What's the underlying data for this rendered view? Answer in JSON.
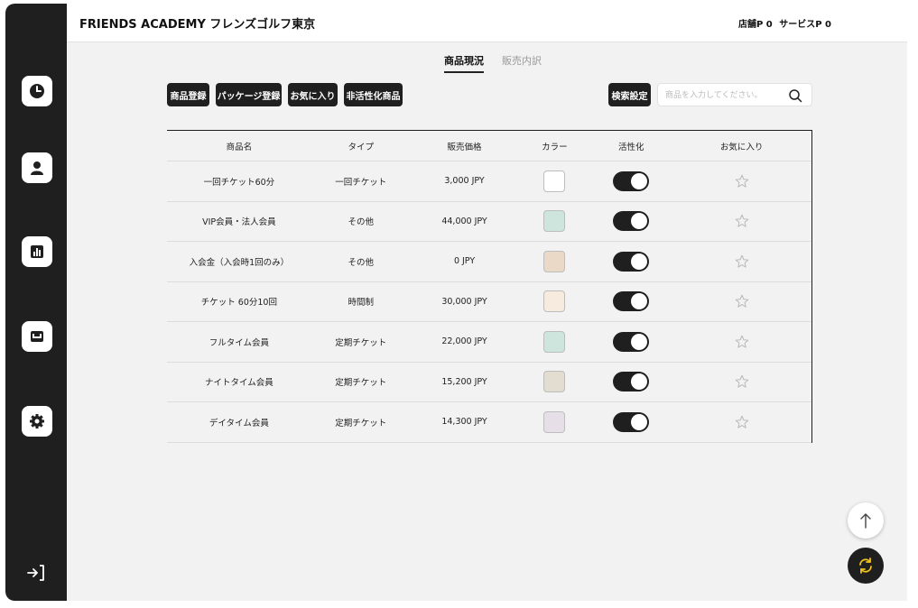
{
  "header": {
    "brand": "FRIENDS ACADEMY フレンズゴルフ東京",
    "store_points": "店舗P 0",
    "service_points": "サービスP 0"
  },
  "tabs": [
    {
      "label": "商品現況",
      "active": true
    },
    {
      "label": "販売内訳",
      "active": false
    }
  ],
  "toolbar": {
    "register_product": "商品登録",
    "register_package": "パッケージ登録",
    "favorites": "お気に入り",
    "inactive_products": "非活性化商品",
    "search_settings": "検索設定",
    "search_placeholder": "商品を入力してください。"
  },
  "table": {
    "columns": [
      "商品名",
      "タイプ",
      "販売価格",
      "カラー",
      "活性化",
      "お気に入り"
    ],
    "rows": [
      {
        "name": "一回チケット60分",
        "type": "一回チケット",
        "price": "3,000 JPY",
        "color": "#ffffff",
        "active": true,
        "favorite": false
      },
      {
        "name": "VIP会員・法人会員",
        "type": "その他",
        "price": "44,000 JPY",
        "color": "#cde5dc",
        "active": true,
        "favorite": false
      },
      {
        "name": "入会金（入会時1回のみ）",
        "type": "その他",
        "price": "0 JPY",
        "color": "#ead9c7",
        "active": true,
        "favorite": false
      },
      {
        "name": "チケット 60分10回",
        "type": "時間制",
        "price": "30,000 JPY",
        "color": "#f7ebdf",
        "active": true,
        "favorite": false
      },
      {
        "name": "フルタイム会員",
        "type": "定期チケット",
        "price": "22,000 JPY",
        "color": "#cde5dc",
        "active": true,
        "favorite": false
      },
      {
        "name": "ナイトタイム会員",
        "type": "定期チケット",
        "price": "15,200 JPY",
        "color": "#e3ddd1",
        "active": true,
        "favorite": false
      },
      {
        "name": "デイタイム会員",
        "type": "定期チケット",
        "price": "14,300 JPY",
        "color": "#e6dfe8",
        "active": true,
        "favorite": false
      }
    ]
  },
  "colors": {
    "sidebar": "#1f1f1f",
    "accent_refresh": "#f0c419"
  },
  "sidebar_icons": [
    "clock-icon",
    "user-icon",
    "chart-icon",
    "inbox-icon",
    "gear-icon",
    "logout-icon"
  ]
}
